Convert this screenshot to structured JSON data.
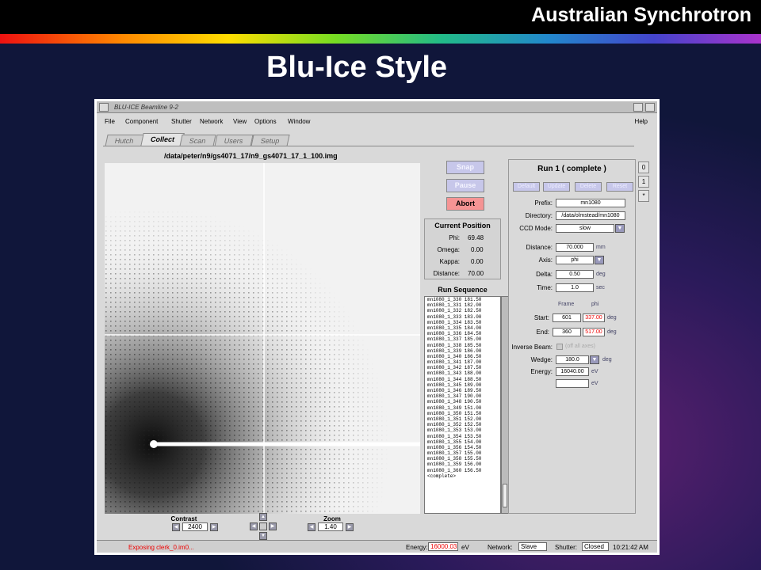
{
  "slide": {
    "brand": "Australian Synchrotron",
    "title": "Blu-Ice Style"
  },
  "window": {
    "title": "BLU-ICE  Beamline 9-2",
    "menu": [
      "File",
      "Component",
      "Shutter",
      "Network",
      "View",
      "Options",
      "Window"
    ],
    "help": "Help",
    "tabs": [
      "Hutch",
      "Collect",
      "Scan",
      "Users",
      "Setup"
    ],
    "active_tab": "Collect",
    "image_path": "/data/peter/n9/gs4071_17/n9_gs4071_17_1_100.img"
  },
  "controls": {
    "snap": "Snap",
    "pause": "Pause",
    "abort": "Abort"
  },
  "current_position": {
    "title": "Current Position",
    "rows": [
      {
        "label": "Phi:",
        "value": "69.48"
      },
      {
        "label": "Omega:",
        "value": "0.00"
      },
      {
        "label": "Kappa:",
        "value": "0.00"
      },
      {
        "label": "Distance:",
        "value": "70.00"
      }
    ]
  },
  "run_sequence": {
    "title": "Run Sequence",
    "items": [
      "mn1080_1_330 181.50",
      "mn1080_1_331 182.00",
      "mn1080_1_332 182.50",
      "mn1080_1_333 183.00",
      "mn1080_1_334 183.50",
      "mn1080_1_335 184.00",
      "mn1080_1_336 184.50",
      "mn1080_1_337 185.00",
      "mn1080_1_338 185.50",
      "mn1080_1_339 186.00",
      "mn1080_1_340 186.50",
      "mn1080_1_341 187.00",
      "mn1080_1_342 187.50",
      "mn1080_1_343 188.00",
      "mn1080_1_344 188.50",
      "mn1080_1_345 189.00",
      "mn1080_1_346 189.50",
      "mn1080_1_347 190.00",
      "mn1080_1_348 190.50",
      "mn1080_1_349 151.00",
      "mn1080_1_350 151.50",
      "mn1080_1_351 152.00",
      "mn1080_1_352 152.50",
      "mn1080_1_353 153.00",
      "mn1080_1_354 153.50",
      "mn1080_1_355 154.00",
      "mn1080_1_356 154.50",
      "mn1080_1_357 155.00",
      "mn1080_1_358 155.50",
      "mn1080_1_359 156.00",
      "mn1080_1_360 156.50",
      "<complete>"
    ]
  },
  "run": {
    "title": "Run 1 ( complete )",
    "buttons": [
      "Default",
      "Update",
      "Delete",
      "Reset"
    ],
    "side_tabs": [
      "0",
      "1",
      "*"
    ],
    "prefix_label": "Prefix:",
    "prefix": "mn1080",
    "directory_label": "Directory:",
    "directory": "/data/olmstead/mn1080",
    "ccd_label": "CCD Mode:",
    "ccd": "slow",
    "distance_label": "Distance:",
    "distance": "70.000",
    "distance_unit": "mm",
    "axis_label": "Axis:",
    "axis": "phi",
    "delta_label": "Delta:",
    "delta": "0.50",
    "delta_unit": "deg",
    "time_label": "Time:",
    "time": "1.0",
    "time_unit": "sec",
    "col_frame": "Frame",
    "col_phi": "phi",
    "start_label": "Start:",
    "start_frame": "601",
    "start_phi": "337.00",
    "start_unit": "deg",
    "end_label": "End:",
    "end_frame": "360",
    "end_phi": "517.00",
    "end_unit": "deg",
    "inverse_label": "Inverse Beam:",
    "inverse_text": "(off all axes)",
    "wedge_label": "Wedge:",
    "wedge": "180.0",
    "wedge_unit": "deg",
    "energy_label": "Energy:",
    "energy": "16040.00",
    "energy_unit": "eV",
    "energy2_unit": "eV"
  },
  "viewer": {
    "contrast_label": "Contrast",
    "contrast": "2400",
    "zoom_label": "Zoom",
    "zoom": "1.40"
  },
  "status": {
    "message": "Exposing clerk_0.im0...",
    "energy_label": "Energy:",
    "energy": "16000.03",
    "energy_unit": "eV",
    "network_label": "Network:",
    "network": "Slave",
    "shutter_label": "Shutter:",
    "shutter": "Closed",
    "time": "10:21:42 AM"
  },
  "colors": {
    "abort": "#f59494",
    "disabled_button": "#c7c7ea",
    "red_value": "#e00000"
  }
}
